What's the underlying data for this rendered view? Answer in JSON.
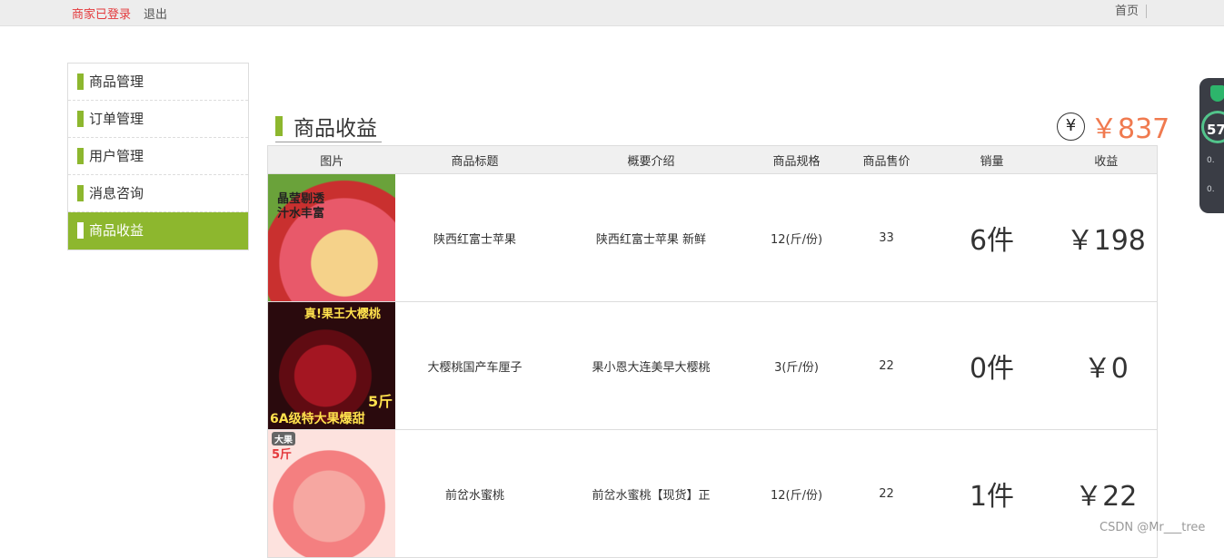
{
  "topbar": {
    "login_status": "商家已登录",
    "logout": "退出",
    "home": "首页"
  },
  "sidebar": {
    "items": [
      {
        "label": "商品管理",
        "active": false
      },
      {
        "label": "订单管理",
        "active": false
      },
      {
        "label": "用户管理",
        "active": false
      },
      {
        "label": "消息咨询",
        "active": false
      },
      {
        "label": "商品收益",
        "active": true
      }
    ]
  },
  "main": {
    "title": "商品收益",
    "total_icon": "yen-circle-icon",
    "total_symbol": "¥",
    "total_amount": "￥837",
    "columns": [
      "图片",
      "商品标题",
      "概要介绍",
      "商品规格",
      "商品售价",
      "销量",
      "收益"
    ],
    "rows": [
      {
        "image": "apple-product-image",
        "title": "陕西红富士苹果",
        "intro": "陕西红富士苹果 新鲜",
        "spec": "12(斤/份)",
        "price": "33",
        "sales": "6件",
        "revenue": "￥198",
        "img_text": [
          "晶莹剔透",
          "汁水丰富"
        ]
      },
      {
        "image": "cherry-product-image",
        "title": "大樱桃国产车厘子",
        "intro": "果小恩大连美早大樱桃",
        "spec": "3(斤/份)",
        "price": "22",
        "sales": "0件",
        "revenue": "￥0",
        "img_text": [
          "真!果王大樱桃",
          "5斤",
          "6A级特大果爆甜"
        ]
      },
      {
        "image": "peach-product-image",
        "title": "前岔水蜜桃",
        "intro": "前岔水蜜桃【现货】正",
        "spec": "12(斤/份)",
        "price": "22",
        "sales": "1件",
        "revenue": "￥22",
        "img_text": [
          "大果",
          "5斤"
        ]
      }
    ]
  },
  "widget": {
    "score": "57",
    "line1": "0.",
    "line2": "0."
  },
  "watermark": "CSDN @Mr___tree",
  "colors": {
    "accent_green": "#8db72e",
    "price_orange": "#f07a4f",
    "login_red": "#e4393c"
  }
}
